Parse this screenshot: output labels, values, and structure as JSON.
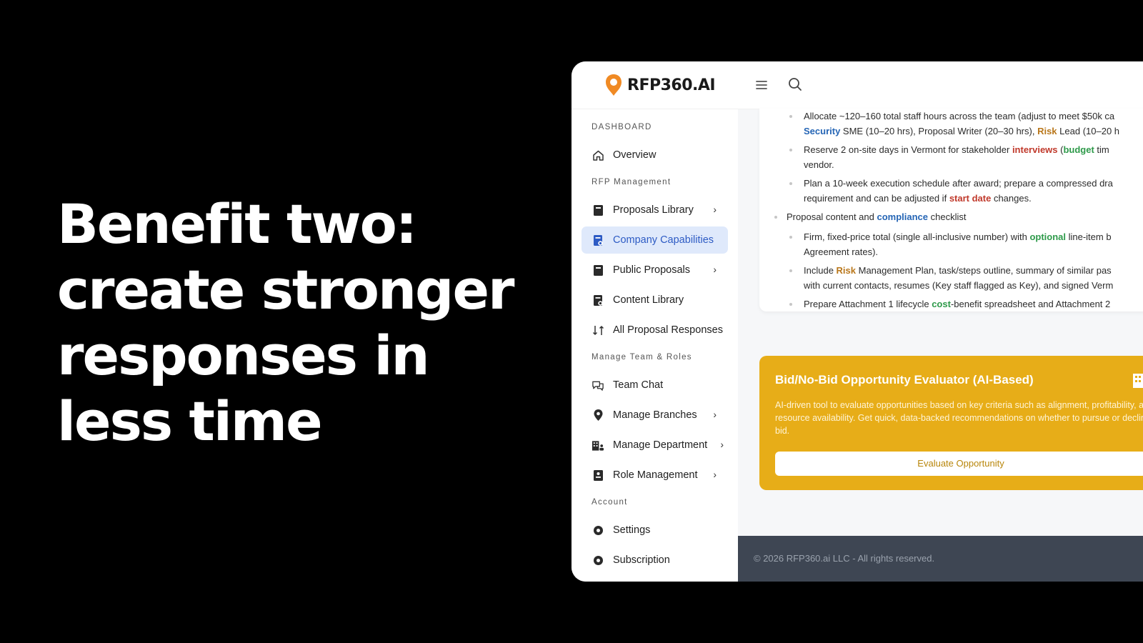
{
  "headline": {
    "lines": [
      "Benefit two:",
      "create stronger",
      "responses in",
      "less time"
    ]
  },
  "app": {
    "logo": "RFP360.AI",
    "sidebar": {
      "sections": {
        "dashboard": "DASHBOARD",
        "rfp": "RFP Management",
        "team": "Manage Team & Roles",
        "account": "Account"
      },
      "items": {
        "overview": "Overview",
        "proposals_library": "Proposals Library",
        "company_capabilities": "Company Capabilities",
        "public_proposals": "Public Proposals",
        "content_library": "Content Library",
        "all_proposal_responses": "All Proposal Responses",
        "team_chat": "Team Chat",
        "manage_branches": "Manage Branches",
        "manage_department": "Manage Department",
        "role_management": "Role Management",
        "settings": "Settings",
        "subscription": "Subscription"
      },
      "active": "company_capabilities"
    },
    "content": {
      "b1": {
        "line1": "Allocate ~120–160 total staff hours across the team (adjust to meet $50k ca",
        "l2_security": "Security",
        "l2_mid": " SME (10–20 hrs), Proposal Writer (20–30 hrs), ",
        "l2_risk": "Risk",
        "l2_end": " Lead (10–20 h"
      },
      "b2": {
        "pre": "Reserve 2 on-site days in Vermont for stakeholder ",
        "interviews": "interviews",
        "paren": " (",
        "budget": "budget",
        "end": " tim",
        "line2": "vendor."
      },
      "b3": {
        "line1": "Plan a 10-week execution schedule after award; prepare a compressed dra",
        "l2_pre": "requirement and can be adjusted if ",
        "start_date": "start date",
        "l2_end": " changes."
      },
      "b4": {
        "pre": "Proposal content and ",
        "compliance": "compliance",
        "end": " checklist"
      },
      "b5": {
        "pre": "Firm, fixed-price total (single all-inclusive number) with ",
        "optional": "optional",
        "end": " line-item b",
        "line2": "Agreement rates)."
      },
      "b6": {
        "pre": "Include ",
        "risk": "Risk",
        "end": " Management Plan, task/steps outline, summary of similar pas",
        "line2": "with current contacts, resumes (Key staff flagged as Key), and signed Verm"
      },
      "b7": {
        "pre": "Prepare Attachment 1 lifecycle ",
        "cost": "cost",
        "end": "-benefit spreadsheet and Attachment 2"
      }
    },
    "bid": {
      "title": "Bid/No-Bid Opportunity Evaluator (AI-Based)",
      "description": "AI-driven tool to evaluate opportunities based on key criteria such as alignment, profitability, and resource availability. Get quick, data-backed recommendations on whether to pursue or decline a bid.",
      "button": "Evaluate Opportunity"
    },
    "footer": "© 2026 RFP360.ai LLC - All rights reserved.",
    "colors": {
      "accent_blue": "#2d5bc4",
      "active_bg": "#dfe9fb",
      "bid_yellow": "#e7ad18",
      "footer_bg": "#3e4653"
    }
  }
}
